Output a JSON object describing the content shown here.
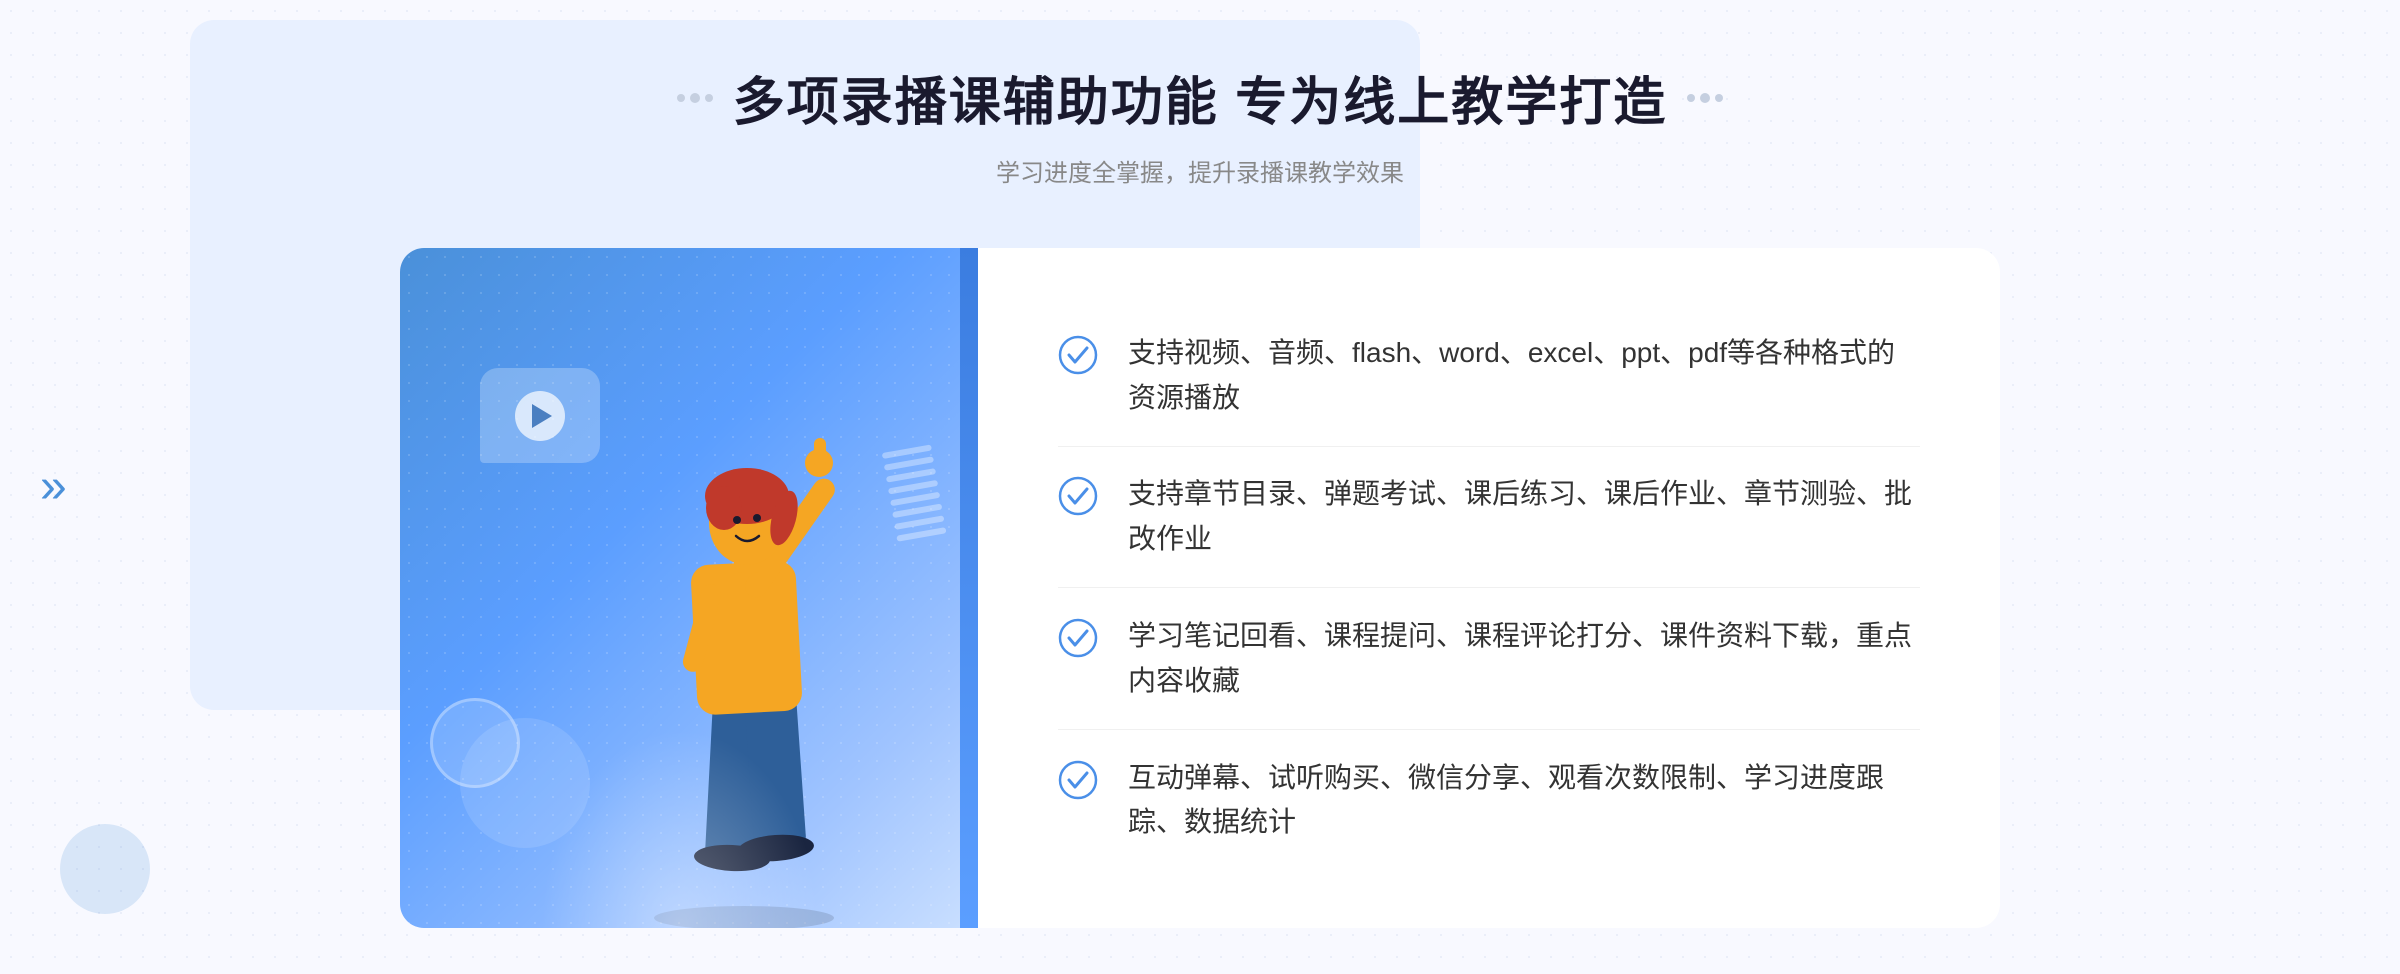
{
  "header": {
    "title": "多项录播课辅助功能 专为线上教学打造",
    "subtitle": "学习进度全掌握，提升录播课教学效果"
  },
  "features": [
    {
      "id": "feature-1",
      "text": "支持视频、音频、flash、word、excel、ppt、pdf等各种格式的资源播放"
    },
    {
      "id": "feature-2",
      "text": "支持章节目录、弹题考试、课后练习、课后作业、章节测验、批改作业"
    },
    {
      "id": "feature-3",
      "text": "学习笔记回看、课程提问、课程评论打分、课件资料下载，重点内容收藏"
    },
    {
      "id": "feature-4",
      "text": "互动弹幕、试听购买、微信分享、观看次数限制、学习进度跟踪、数据统计"
    }
  ],
  "icons": {
    "check": "check-circle-icon",
    "play": "play-icon",
    "left_arrow": "«"
  },
  "colors": {
    "primary_blue": "#4a90d9",
    "dark_text": "#1a1a2e",
    "subtitle_gray": "#888888",
    "feature_text": "#333333",
    "check_blue": "#4a8fe8",
    "bg_light": "#f8f9ff",
    "white": "#ffffff"
  }
}
